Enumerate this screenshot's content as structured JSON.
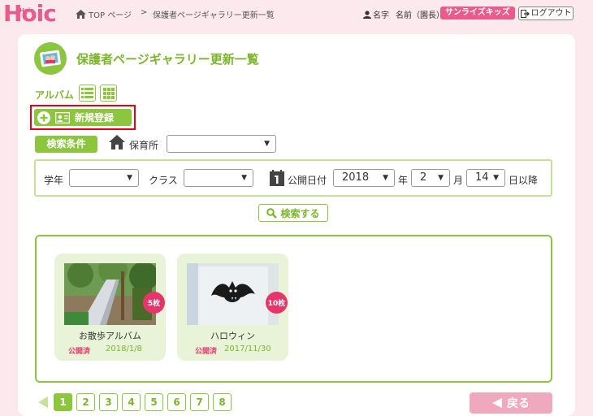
{
  "header": {
    "logo": "Hoic",
    "logo_small": "Hoic",
    "breadcrumb_home": "TOP ページ",
    "breadcrumb_sep": ">",
    "breadcrumb_current": "保護者ページギャラリー更新一覧",
    "user_name": "名字",
    "user_role": "名前（園長）",
    "facility": "サンライズキッズ",
    "logout": "ログアウト"
  },
  "page": {
    "title": "保護者ページギャラリー更新一覧",
    "album_label": "アルバム",
    "new_button": "新規登録"
  },
  "filters": {
    "condition_label": "検索条件",
    "facility_label": "保育所",
    "facility_value": "",
    "grade_label": "学年",
    "grade_value": "",
    "class_label": "クラス",
    "class_value": "",
    "date_label": "公開日付",
    "year_value": "2018",
    "year_unit": "年",
    "month_value": "2",
    "month_unit": "月",
    "day_value": "14",
    "day_unit": "日以降",
    "search_button": "検索する"
  },
  "albums": [
    {
      "name": "お散歩アルバム",
      "count": "5枚",
      "status": "公開済",
      "date": "2018/1/8"
    },
    {
      "name": "ハロウィン",
      "count": "10枚",
      "status": "公開済",
      "date": "2017/11/30"
    }
  ],
  "pager": {
    "pages": [
      "1",
      "2",
      "3",
      "4",
      "5",
      "6",
      "7",
      "8"
    ],
    "back": "戻る"
  },
  "colors": {
    "accent_green": "#8cc63f",
    "accent_pink": "#ea5a8b",
    "highlight_red": "#e60012"
  }
}
